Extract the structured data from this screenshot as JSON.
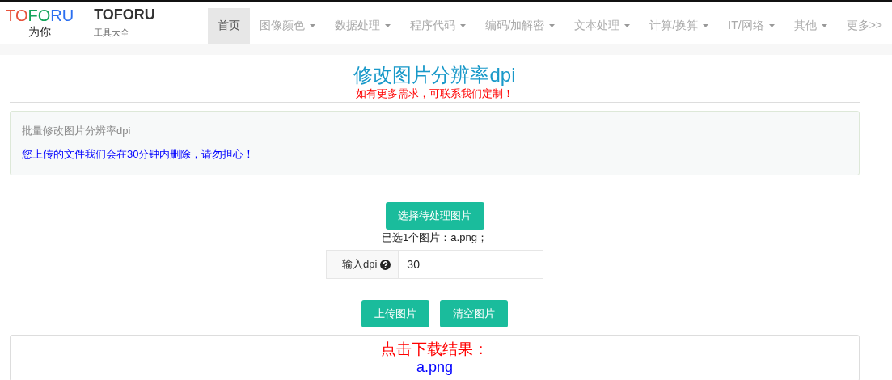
{
  "logo": {
    "parts": [
      {
        "text": "TO",
        "color": "#e8533c"
      },
      {
        "text": "FO",
        "color": "#14a45a"
      },
      {
        "text": "RU",
        "color": "#2b6ff0"
      }
    ],
    "tagline": "为你"
  },
  "brand": {
    "title": "TOFORU",
    "subtitle": "工具大全"
  },
  "nav": [
    {
      "label": "首页",
      "selected": true,
      "dropdown": false
    },
    {
      "label": "图像颜色",
      "selected": false,
      "dropdown": true
    },
    {
      "label": "数据处理",
      "selected": false,
      "dropdown": true
    },
    {
      "label": "程序代码",
      "selected": false,
      "dropdown": true
    },
    {
      "label": "编码/加解密",
      "selected": false,
      "dropdown": true
    },
    {
      "label": "文本处理",
      "selected": false,
      "dropdown": true
    },
    {
      "label": "计算/换算",
      "selected": false,
      "dropdown": true
    },
    {
      "label": "IT/网络",
      "selected": false,
      "dropdown": true
    },
    {
      "label": "其他",
      "selected": false,
      "dropdown": true
    },
    {
      "label": "更多>>",
      "selected": false,
      "dropdown": false
    }
  ],
  "page": {
    "title": "修改图片分辨率dpi",
    "subtitle": "如有更多需求，可联系我们定制！"
  },
  "panel": {
    "heading": "批量修改图片分辨率dpi",
    "notice": "您上传的文件我们会在30分钟内删除，请勿担心！"
  },
  "select_button": "选择待处理图片",
  "selected_files": "已选1个图片：a.png；",
  "dpi": {
    "label": "输入dpi",
    "value": "30"
  },
  "buttons": [
    "上传图片",
    "清空图片"
  ],
  "result": {
    "heading": "点击下载结果：",
    "link": "a.png"
  }
}
